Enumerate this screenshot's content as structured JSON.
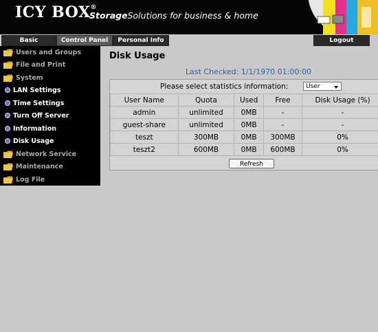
{
  "brand": {
    "logo": "ICY BOX",
    "registered": "®",
    "tagline_bold": "Storage",
    "tagline_rest": "Solutions for business & home"
  },
  "tabs": [
    {
      "label": "Basic"
    },
    {
      "label": "Control Panel",
      "active": true
    },
    {
      "label": "Personal Info"
    }
  ],
  "logout_label": "Logout",
  "sidebar": {
    "items": [
      {
        "label": "Users and Groups",
        "type": "folder"
      },
      {
        "label": "File and Print",
        "type": "folder"
      },
      {
        "label": "System",
        "type": "folder"
      },
      {
        "label": "LAN Settings",
        "type": "sub"
      },
      {
        "label": "Time Settings",
        "type": "sub"
      },
      {
        "label": "Turn Off Server",
        "type": "sub"
      },
      {
        "label": "Information",
        "type": "sub"
      },
      {
        "label": "Disk Usage",
        "type": "sub",
        "active": true
      },
      {
        "label": "Network Service",
        "type": "folder"
      },
      {
        "label": "Maintenance",
        "type": "folder"
      },
      {
        "label": "Log File",
        "type": "folder"
      }
    ]
  },
  "main": {
    "title": "Disk Usage",
    "last_checked": "Last Checked: 1/1/1970 01:00:00",
    "select_label": "Please select statistics information:",
    "select_value": "User",
    "columns": [
      "User Name",
      "Quota",
      "Used",
      "Free",
      "Disk Usage (%)"
    ],
    "rows": [
      [
        "admin",
        "unlimited",
        "0MB",
        "-",
        "-"
      ],
      [
        "guest-share",
        "unlimited",
        "0MB",
        "-",
        "-"
      ],
      [
        "teszt",
        "300MB",
        "0MB",
        "300MB",
        "0%"
      ],
      [
        "teszt2",
        "600MB",
        "0MB",
        "600MB",
        "0%"
      ]
    ],
    "refresh_label": "Refresh"
  },
  "colors": {
    "accent_link": "#2a63a6",
    "sidebar_bg": "#000000",
    "page_bg": "#c9c9c9"
  }
}
